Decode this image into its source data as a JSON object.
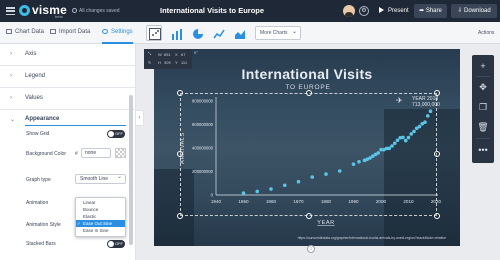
{
  "topbar": {
    "logo": "visme",
    "logo_sub": "beta",
    "saved_status": "All changes saved",
    "doc_title": "International Visits to Europe",
    "present_label": "Present",
    "share_label": "Share",
    "download_label": "Download",
    "dark": "#1f2836"
  },
  "tabs": {
    "chart_data": "Chart Data",
    "import_data": "Import Data",
    "settings": "Settings",
    "more_charts": "More Charts",
    "actions": "Actions",
    "accent": "#2a8fe0"
  },
  "panel": {
    "axis": "Axis",
    "legend": "Legend",
    "values": "Values",
    "appearance": "Appearance",
    "show_grid_label": "Show Grid",
    "show_grid_state": "OFF",
    "bg_color_label": "Background Color",
    "bg_color_value": "none",
    "graph_type_label": "Graph type",
    "graph_type_value": "Smooth Line",
    "animation_label": "Animation",
    "animation_style_label": "Animation Style",
    "animation_options": [
      "Linear",
      "Bounce",
      "Elastic",
      "Ease Out Sine",
      "Ease In Sine"
    ],
    "animation_selected": "Ease Out Sine",
    "stacked_bars_label": "Stacked Bars",
    "stacked_bars_state": "OFF"
  },
  "info": {
    "w_label": "W",
    "w_value": "651",
    "x_label": "X",
    "x_value": "67",
    "h_label": "H",
    "h_value": "309",
    "y_label": "Y",
    "y_value": "111",
    "rotation": "0°"
  },
  "chart_data": {
    "type": "scatter",
    "title": "International Visits",
    "subtitle": "TO EUROPE",
    "xlabel": "YEAR",
    "ylabel": "ARRIVALS",
    "xlim": [
      1940,
      2020
    ],
    "ylim": [
      0,
      800000000
    ],
    "x_ticks": [
      1940,
      1950,
      1960,
      1970,
      1980,
      1990,
      2000,
      2010,
      2020
    ],
    "y_ticks": [
      0,
      200000000,
      400000000,
      600000000,
      800000000
    ],
    "y_tick_labels": [
      "0",
      "200000000",
      "400000000",
      "600000000",
      "800000000"
    ],
    "point_color": "#5bc5e8",
    "annotation": {
      "label": "YEAR 2018",
      "value": "713,000,000"
    },
    "source": "https://ourworldindata.org/grapher/international-tourist-arrivals-by-world-region?stackMode=relative",
    "series": [
      {
        "x": [
          1950,
          1955,
          1960,
          1965,
          1970,
          1975,
          1980,
          1985,
          1990,
          1992,
          1994,
          1995,
          1996,
          1997,
          1998,
          1999,
          2000,
          2001,
          2002,
          2003,
          2004,
          2005,
          2006,
          2007,
          2008,
          2009,
          2010,
          2011,
          2012,
          2013,
          2014,
          2015,
          2016,
          2017,
          2018
        ],
        "y": [
          17000000,
          30000000,
          51000000,
          83000000,
          113000000,
          153000000,
          178000000,
          204000000,
          262000000,
          283000000,
          295000000,
          304000000,
          315000000,
          330000000,
          345000000,
          358000000,
          386000000,
          385000000,
          396000000,
          397000000,
          417000000,
          440000000,
          466000000,
          487000000,
          490000000,
          463000000,
          489000000,
          520000000,
          541000000,
          568000000,
          583000000,
          606000000,
          620000000,
          673000000,
          713000000
        ]
      }
    ]
  }
}
